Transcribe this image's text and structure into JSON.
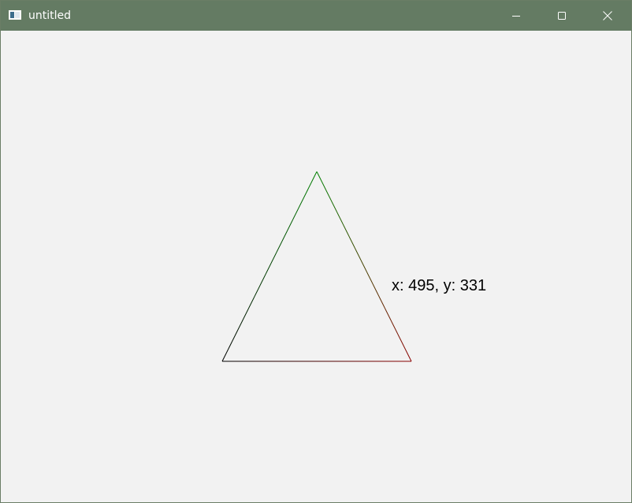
{
  "window": {
    "title": "untitled",
    "titlebar_color": "#647b63",
    "background_color": "#f2f2f2",
    "controls": {
      "minimize_icon": "minimize-icon",
      "maximize_icon": "maximize-icon",
      "close_icon": "close-icon"
    }
  },
  "canvas": {
    "coordinate_readout": "x: 495, y: 331",
    "triangle_colors": {
      "apex": "#008000",
      "bottom_left": "#000000",
      "bottom_right": "#8b0000"
    }
  }
}
